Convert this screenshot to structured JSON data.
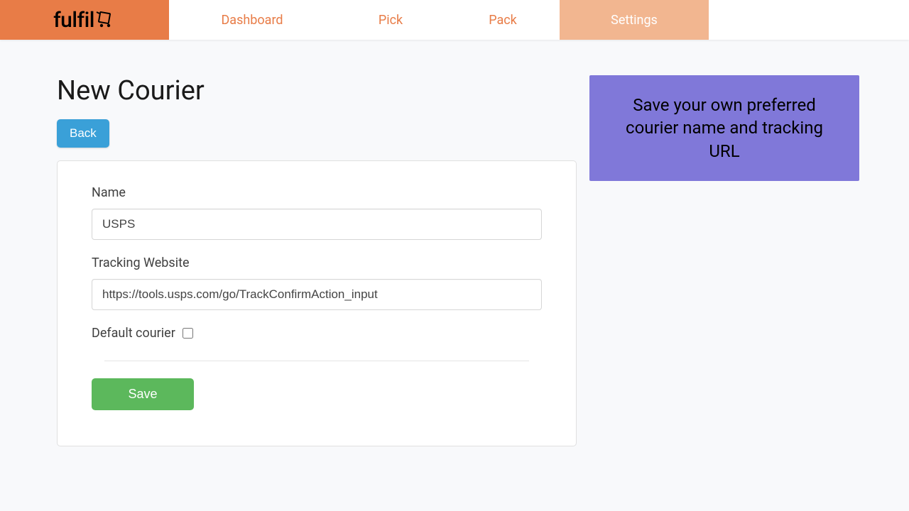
{
  "brand": {
    "name": "fulfil"
  },
  "nav": {
    "dashboard": "Dashboard",
    "pick": "Pick",
    "pack": "Pack",
    "settings": "Settings"
  },
  "page": {
    "title": "New Courier",
    "back_label": "Back"
  },
  "form": {
    "name_label": "Name",
    "name_value": "USPS",
    "tracking_label": "Tracking Website",
    "tracking_value": "https://tools.usps.com/go/TrackConfirmAction_input",
    "default_courier_label": "Default courier",
    "default_courier_checked": false,
    "save_label": "Save"
  },
  "info": {
    "text": "Save your own preferred courier name and tracking URL"
  }
}
